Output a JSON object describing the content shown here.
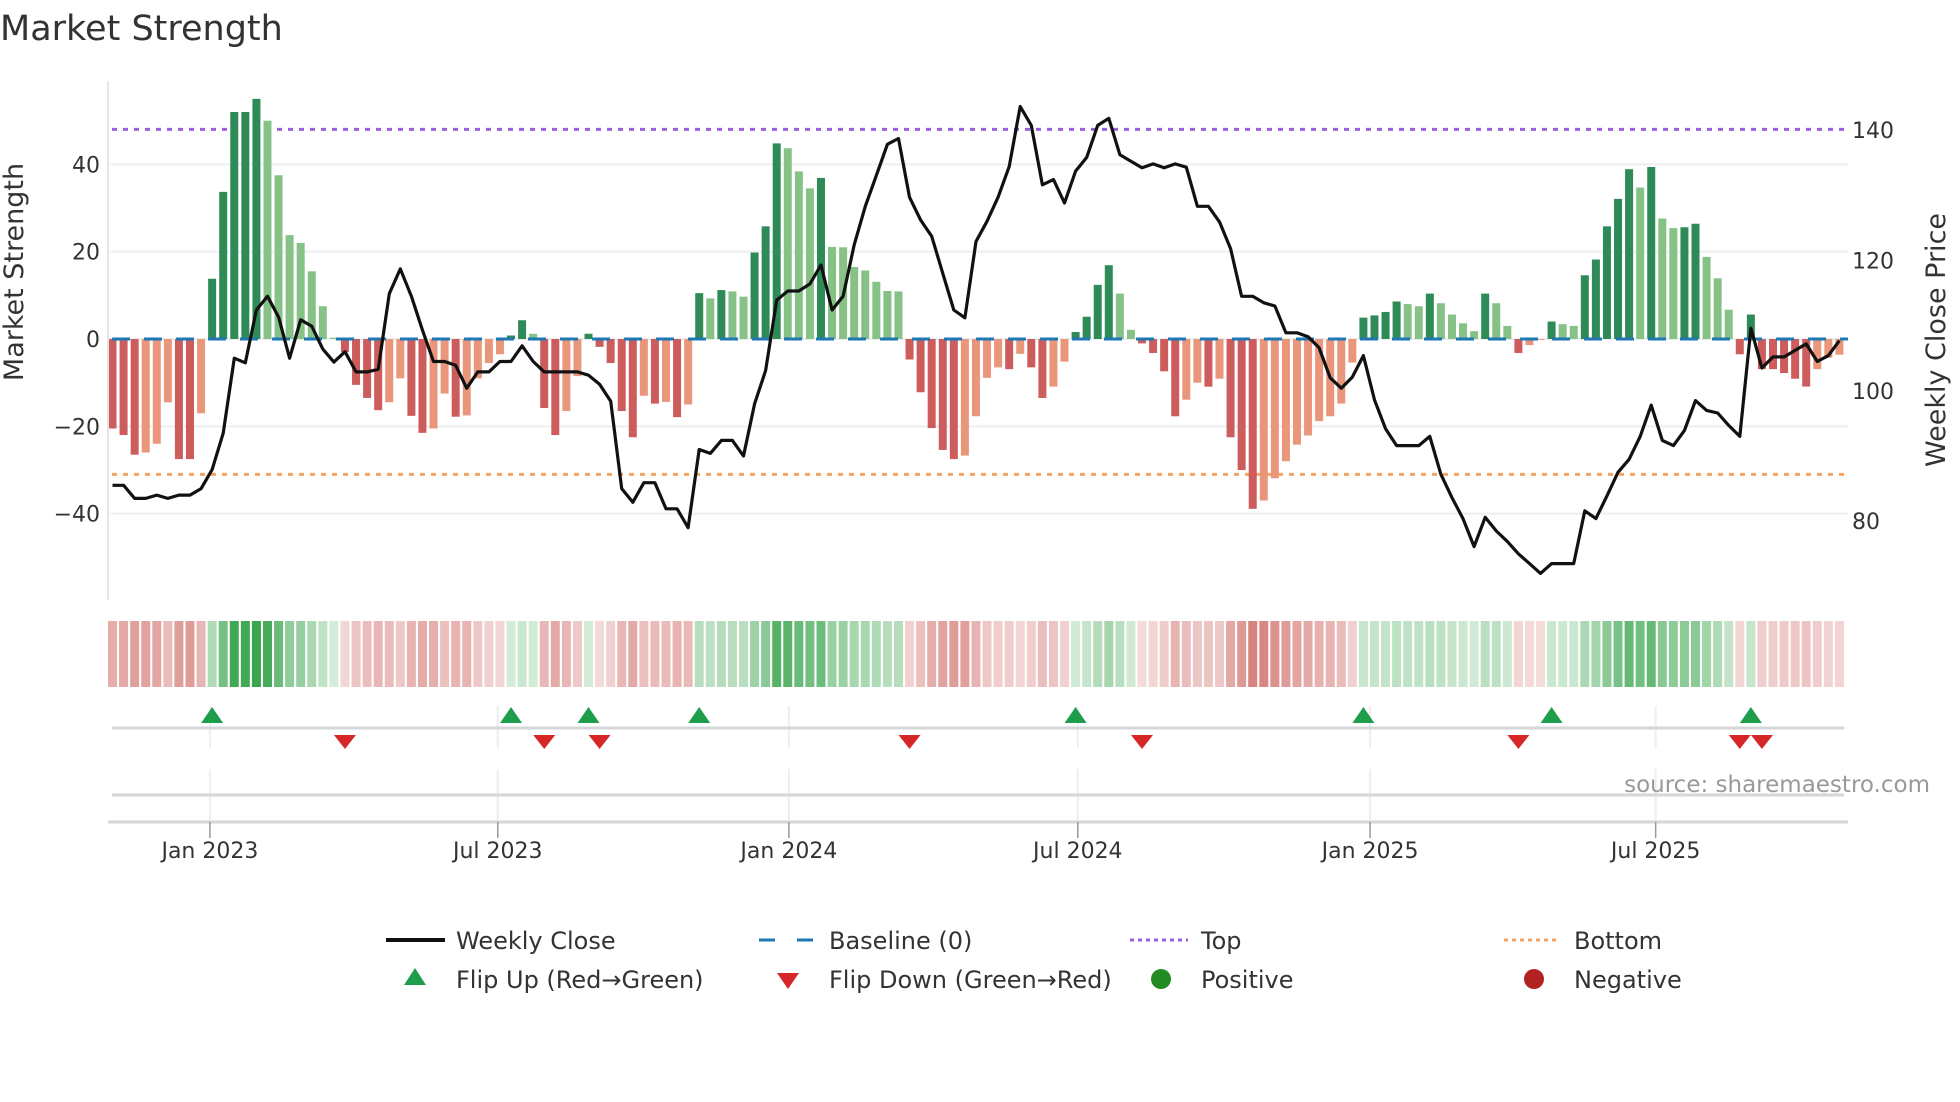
{
  "chart_data": {
    "type": "bar",
    "title": "Market Strength",
    "ylabel": "Market Strength",
    "y2label": "Weekly Close Price",
    "ylim": [
      -60,
      59
    ],
    "y2lim": [
      67,
      149
    ],
    "yticks": [
      -40,
      -20,
      0,
      20,
      40
    ],
    "yticklabels": [
      "−40",
      "−20",
      "0",
      "20",
      "40"
    ],
    "y2ticks": [
      80,
      100,
      120,
      140
    ],
    "y2ticklabels": [
      "80",
      "100",
      "120",
      "140"
    ],
    "top_level": 48,
    "bottom_level": -31,
    "baseline": 0,
    "x_unit": "week index",
    "xticks": [
      {
        "week": 9.8,
        "label": "Jan 2023"
      },
      {
        "week": 35.8,
        "label": "Jul 2023"
      },
      {
        "week": 62.1,
        "label": "Jan 2024"
      },
      {
        "week": 88.2,
        "label": "Jul 2024"
      },
      {
        "week": 114.6,
        "label": "Jan 2025"
      },
      {
        "week": 140.4,
        "label": "Jul 2025"
      }
    ],
    "strength": [
      -20.5,
      -22,
      -26.5,
      -26,
      -24,
      -14.5,
      -27.5,
      -27.5,
      -17,
      13.8,
      33.7,
      52,
      52,
      55,
      50,
      37.5,
      23.8,
      22,
      15.5,
      7.5,
      0.3,
      -3,
      -10.5,
      -13.5,
      -16.3,
      -14.5,
      -9,
      -17.6,
      -21.5,
      -20.5,
      -12.5,
      -17.8,
      -17.5,
      -9,
      -5.5,
      -3.5,
      0.8,
      4.3,
      1.2,
      -15.8,
      -22,
      -16.5,
      -8.5,
      1.2,
      -1.8,
      -5.5,
      -16.5,
      -22.5,
      -13,
      -14.8,
      -14.4,
      -17.9,
      -15,
      10.5,
      9.3,
      11.2,
      10.9,
      9.7,
      19.8,
      25.8,
      44.8,
      43.7,
      38.4,
      34.5,
      36.9,
      21.1,
      21,
      16.5,
      15.7,
      13.1,
      11,
      10.9,
      -4.7,
      -12.2,
      -20.4,
      -25.4,
      -27.5,
      -26.7,
      -17.7,
      -8.9,
      -6.5,
      -6.9,
      -3.4,
      -6.5,
      -13.5,
      -10.9,
      -5.2,
      1.6,
      5.1,
      12.4,
      16.9,
      10.4,
      2.1,
      -1,
      -3.2,
      -7.4,
      -17.7,
      -13.9,
      -10,
      -10.9,
      -9.1,
      -22.5,
      -30,
      -38.9,
      -37,
      -31.9,
      -28,
      -24.2,
      -22.1,
      -18.8,
      -17.7,
      -14.8,
      -5.4,
      4.9,
      5.4,
      6.2,
      8.6,
      8,
      7.5,
      10.4,
      8.2,
      5.6,
      3.6,
      1.8,
      10.4,
      8.2,
      3,
      -3.2,
      -1.4,
      -0.2,
      4,
      3.4,
      3,
      14.6,
      18.2,
      25.8,
      32.1,
      38.9,
      34.7,
      39.4,
      27.6,
      25.4,
      25.6,
      26.4,
      18.8,
      13.9,
      6.7,
      -3.5,
      5.6,
      -6.9,
      -6.9,
      -7.8,
      -9.1,
      -10.9,
      -6.9,
      -4.3,
      -3.6
    ],
    "weekly_close": [
      85.5,
      85.5,
      83.5,
      83.5,
      84,
      83.5,
      84,
      84,
      85,
      87.9,
      93.5,
      105,
      104.3,
      112.4,
      114.5,
      111.3,
      105,
      110.9,
      109.9,
      106.4,
      104.4,
      106,
      102.9,
      102.9,
      103.3,
      114.9,
      118.7,
      114.5,
      109.3,
      104.5,
      104.5,
      103.9,
      100.4,
      102.9,
      102.9,
      104.5,
      104.5,
      106.9,
      104.5,
      102.9,
      102.9,
      102.9,
      102.9,
      102.4,
      101,
      98.4,
      85,
      82.9,
      85.9,
      85.9,
      81.9,
      81.9,
      79,
      91,
      90.4,
      92.4,
      92.4,
      90,
      98,
      103.1,
      113.9,
      115.3,
      115.3,
      116.4,
      119.3,
      112.4,
      114.5,
      122.4,
      128.3,
      133,
      137.8,
      138.7,
      129.7,
      126.2,
      123.7,
      118,
      112.4,
      111.2,
      122.9,
      126,
      129.7,
      134.4,
      143.6,
      140.7,
      131.6,
      132.4,
      128.8,
      133.7,
      135.8,
      140.7,
      141.8,
      136.2,
      135.2,
      134.2,
      134.8,
      134.2,
      134.8,
      134.3,
      128.3,
      128.3,
      125.9,
      121.8,
      114.5,
      114.5,
      113.5,
      113,
      108.9,
      108.9,
      108.3,
      106.6,
      102,
      100.4,
      102.1,
      105.4,
      98.6,
      94.2,
      91.6,
      91.6,
      91.6,
      93,
      87.2,
      83.6,
      80.4,
      76.1,
      80.6,
      78.5,
      76.9,
      75,
      73.5,
      72,
      73.5,
      73.5,
      73.5,
      81.6,
      80.4,
      83.9,
      87.5,
      89.5,
      93,
      97.8,
      92.4,
      91.6,
      93.9,
      98.5,
      97,
      96.6,
      94.7,
      93,
      109.6,
      103.5,
      105.2,
      105.2,
      106.2,
      107.2,
      104.5,
      105.4,
      107.7
    ],
    "flip_up_weeks": [
      10,
      37,
      44,
      54,
      88,
      114,
      131,
      149
    ],
    "flip_down_weeks": [
      22,
      40,
      45,
      73,
      94,
      128,
      148,
      150
    ],
    "legend": {
      "placement": "bottom",
      "items": [
        {
          "label": "Weekly Close",
          "kind": "line"
        },
        {
          "label": "Baseline (0)",
          "kind": "dash"
        },
        {
          "label": "Top",
          "kind": "dot-top"
        },
        {
          "label": "Bottom",
          "kind": "dot-bottom"
        },
        {
          "label": "Flip Up (Red→Green)",
          "kind": "tri-up"
        },
        {
          "label": "Flip Down (Green→Red)",
          "kind": "tri-down"
        },
        {
          "label": "Positive",
          "kind": "circle-pos"
        },
        {
          "label": "Negative",
          "kind": "circle-neg"
        }
      ]
    },
    "source": "source: sharemaestro.com",
    "colors": {
      "pos_strong": "#2e8b57",
      "pos_weak": "#86c286",
      "neg_strong": "#cd5c5c",
      "neg_weak": "#e9967a",
      "close": "#111111",
      "baseline": "#1f77b4",
      "top": "#9b5fe0",
      "bottom": "#f4a460",
      "flip_up": "#1e9e4a",
      "flip_down": "#d62728",
      "positive": "#228b22",
      "negative": "#b22222"
    }
  }
}
